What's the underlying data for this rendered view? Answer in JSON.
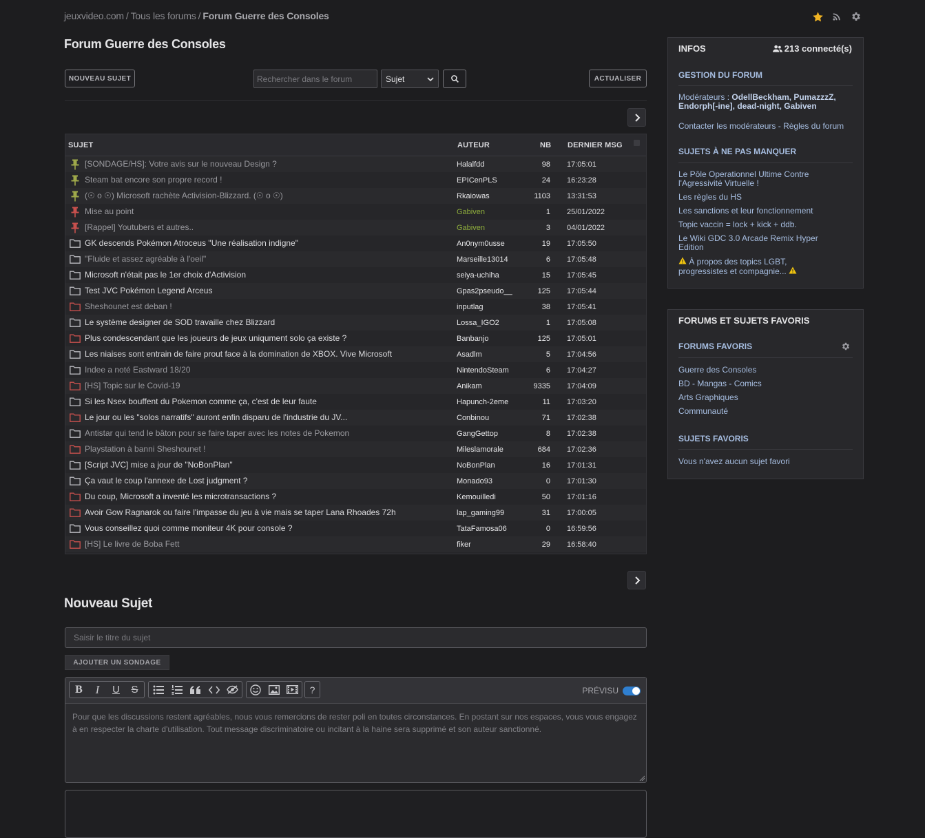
{
  "breadcrumb": {
    "items": [
      "jeuxvideo.com",
      "Tous les forums",
      "Forum Guerre des Consoles"
    ],
    "separator": "/"
  },
  "forum_title": "Forum Guerre des Consoles",
  "toolbar": {
    "new_topic_label": "NOUVEAU SUJET",
    "search_placeholder": "Rechercher dans le forum",
    "search_scope": "Sujet",
    "refresh_label": "ACTUALISER"
  },
  "table": {
    "headers": {
      "subject": "SUJET",
      "author": "AUTEUR",
      "count": "NB",
      "last": "DERNIER MSG"
    },
    "rows": [
      {
        "icon": "pin-green-icon",
        "subject": "[SONDAGE/HS]: Votre avis sur le nouveau Design ?",
        "author": "Halalfdd",
        "nb": "98",
        "last": "17:05:01",
        "read": true,
        "mod": false
      },
      {
        "icon": "pin-green-icon",
        "subject": "Steam bat encore son propre record !",
        "author": "EPICenPLS",
        "nb": "24",
        "last": "16:23:28",
        "read": true,
        "mod": false
      },
      {
        "icon": "pin-green-icon",
        "subject": "(☉ o ☉) Microsoft rachète Activision-Blizzard. (☉ o ☉)",
        "author": "Rkaiowas",
        "nb": "1103",
        "last": "13:31:53",
        "read": true,
        "mod": false
      },
      {
        "icon": "pin-red-icon",
        "subject": "Mise au point",
        "author": "Gabiven",
        "nb": "1",
        "last": "25/01/2022",
        "read": true,
        "mod": true
      },
      {
        "icon": "pin-red-icon",
        "subject": "[Rappel] Youtubers et autres..",
        "author": "Gabiven",
        "nb": "3",
        "last": "04/01/2022",
        "read": true,
        "mod": true
      },
      {
        "icon": "folder-grey-icon",
        "subject": "GK descends Pokémon Atroceus \"Une réalisation indigne\"",
        "author": "An0nym0usse",
        "nb": "19",
        "last": "17:05:50",
        "read": false,
        "mod": false
      },
      {
        "icon": "folder-grey-icon",
        "subject": "\"Fluide et assez agréable à l'oeil\"",
        "author": "Marseille13014",
        "nb": "6",
        "last": "17:05:48",
        "read": true,
        "mod": false
      },
      {
        "icon": "folder-grey-icon",
        "subject": "Microsoft n'était pas le 1er choix d'Activision",
        "author": "seiya-uchiha",
        "nb": "15",
        "last": "17:05:45",
        "read": false,
        "mod": false
      },
      {
        "icon": "folder-grey-icon",
        "subject": "Test JVC Pokémon Legend Arceus",
        "author": "Gpas2pseudo__",
        "nb": "125",
        "last": "17:05:44",
        "read": false,
        "mod": false
      },
      {
        "icon": "folder-red-icon",
        "subject": "Sheshounet est deban !",
        "author": "inputlag",
        "nb": "38",
        "last": "17:05:41",
        "read": true,
        "mod": false
      },
      {
        "icon": "folder-grey-icon",
        "subject": "Le système designer de SOD travaille chez Blizzard",
        "author": "Lossa_IGO2",
        "nb": "1",
        "last": "17:05:08",
        "read": false,
        "mod": false
      },
      {
        "icon": "folder-red-icon",
        "subject": "Plus condescendant que les joueurs de jeux uniqument solo ça existe ?",
        "author": "Banbanjo",
        "nb": "125",
        "last": "17:05:01",
        "read": false,
        "mod": false
      },
      {
        "icon": "folder-grey-icon",
        "subject": "Les niaises sont entrain de faire prout face à la domination de XBOX. Vive Microsoft",
        "author": "Asadlm",
        "nb": "5",
        "last": "17:04:56",
        "read": false,
        "mod": false
      },
      {
        "icon": "folder-grey-icon",
        "subject": "Indee a noté Eastward 18/20",
        "author": "NintendoSteam",
        "nb": "6",
        "last": "17:04:27",
        "read": true,
        "mod": false
      },
      {
        "icon": "folder-red-icon",
        "subject": "[HS] Topic sur le Covid-19",
        "author": "Anikam",
        "nb": "9335",
        "last": "17:04:09",
        "read": true,
        "mod": false
      },
      {
        "icon": "folder-grey-icon",
        "subject": "Si les Nsex bouffent du Pokemon comme ça, c'est de leur faute",
        "author": "Hapunch-2eme",
        "nb": "11",
        "last": "17:03:20",
        "read": false,
        "mod": false
      },
      {
        "icon": "folder-red-icon",
        "subject": "Le jour ou les \"solos narratifs\" auront enfin disparu de l'industrie du JV...",
        "author": "Conbinou",
        "nb": "71",
        "last": "17:02:38",
        "read": false,
        "mod": false
      },
      {
        "icon": "folder-grey-icon",
        "subject": "Antistar qui tend le bâton pour se faire taper avec les notes de Pokemon",
        "author": "GangGettop",
        "nb": "8",
        "last": "17:02:38",
        "read": true,
        "mod": false
      },
      {
        "icon": "folder-red-icon",
        "subject": "Playstation à banni Sheshounet !",
        "author": "Mileslamorale",
        "nb": "684",
        "last": "17:02:36",
        "read": true,
        "mod": false
      },
      {
        "icon": "folder-grey-icon",
        "subject": "[Script JVC] mise a jour de \"NoBonPlan\"",
        "author": "NoBonPlan",
        "nb": "16",
        "last": "17:01:31",
        "read": false,
        "mod": false
      },
      {
        "icon": "folder-grey-icon",
        "subject": "Ça vaut le coup l'annexe de Lost judgment ?",
        "author": "Monado93",
        "nb": "0",
        "last": "17:01:30",
        "read": false,
        "mod": false
      },
      {
        "icon": "folder-red-icon",
        "subject": "Du coup, Microsoft a inventé les microtransactions ?",
        "author": "Kemouilledi",
        "nb": "50",
        "last": "17:01:16",
        "read": false,
        "mod": false
      },
      {
        "icon": "folder-red-icon",
        "subject": "Avoir Gow Ragnarok ou faire l'impasse du jeu à vie mais se taper Lana Rhoades 72h",
        "author": "lap_gaming99",
        "nb": "31",
        "last": "17:00:05",
        "read": false,
        "mod": false
      },
      {
        "icon": "folder-grey-icon",
        "subject": "Vous conseillez quoi comme moniteur 4K pour console ?",
        "author": "TataFamosa06",
        "nb": "0",
        "last": "16:59:56",
        "read": false,
        "mod": false
      },
      {
        "icon": "folder-red-icon",
        "subject": "[HS] Le livre de Boba Fett",
        "author": "fiker",
        "nb": "29",
        "last": "16:58:40",
        "read": true,
        "mod": false
      }
    ]
  },
  "infos": {
    "title": "INFOS",
    "connected": "213 connecté(s)",
    "gestion_title": "GESTION DU FORUM",
    "moderators_prefix": "Modérateurs : ",
    "moderators_line1": "OdellBeckham, PumazzzZ,",
    "moderators_line2": "Endorph[-ine], dead-night, Gabiven",
    "contact": "Contacter les modérateurs",
    "rules": "Règles du forum",
    "contact_sep": " - ",
    "must_title": "SUJETS À NE PAS MANQUER",
    "must_links": [
      "Le Pôle Operationnel Ultime Contre l'Agressivité Virtuelle !",
      "Les règles du HS",
      "Les sanctions et leur fonctionnement",
      "Topic vaccin = lock + kick + ddb.",
      "Le Wiki GDC 3.0 Arcade Remix Hyper Edition",
      "À propos des topics LGBT, progressistes et compagnie..."
    ]
  },
  "favorites": {
    "title": "FORUMS ET SUJETS FAVORIS",
    "forums_title": "FORUMS FAVORIS",
    "forums": [
      "Guerre des Consoles",
      "BD - Mangas - Comics",
      "Arts Graphiques",
      "Communauté"
    ],
    "subjects_title": "SUJETS FAVORIS",
    "subjects_empty": "Vous n'avez aucun sujet favori"
  },
  "new_topic": {
    "title": "Nouveau Sujet",
    "subject_placeholder": "Saisir le titre du sujet",
    "poll_label": "AJOUTER UN SONDAGE",
    "preview_label": "PRÉVISU",
    "editor_placeholder": "Pour que les discussions restent agréables, nous vous remercions de rester poli en toutes circonstances. En postant sur nos espaces, vous vous engagez à en respecter la charte d'utilisation. Tout message discriminatoire ou incitant à la haine sera supprimé et son auteur sanctionné."
  },
  "colors": {
    "background": "#1d1d1f",
    "link": "#a6bde0",
    "moderator": "#8fae3c",
    "pin_green": "#9fa94a",
    "pin_red": "#c8504d",
    "star": "#f0b323",
    "toggle": "#2f7fd0"
  }
}
